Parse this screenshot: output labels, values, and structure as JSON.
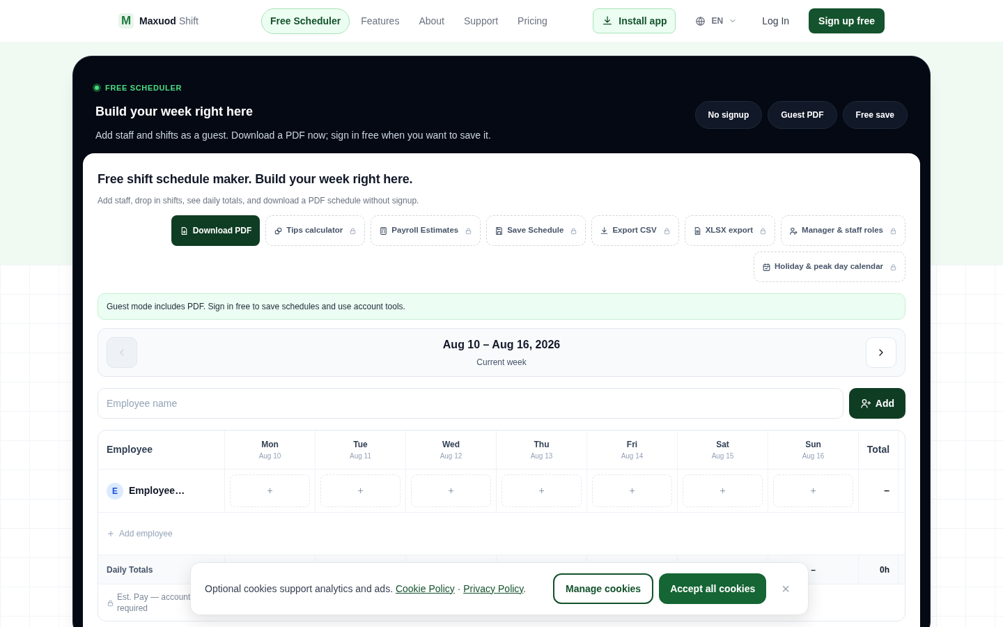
{
  "header": {
    "logo_mark": "M",
    "brand": "Maxuod",
    "brand_suffix": "Shift",
    "nav": [
      {
        "label": "Free Scheduler",
        "selected": true
      },
      {
        "label": "Features",
        "selected": false
      },
      {
        "label": "About",
        "selected": false
      },
      {
        "label": "Support",
        "selected": false
      },
      {
        "label": "Pricing",
        "selected": false
      }
    ],
    "install": "Install app",
    "language": "EN",
    "login": "Log In",
    "signup": "Sign up free"
  },
  "hero": {
    "eyebrow": "FREE SCHEDULER",
    "title": "Build your week right here",
    "subtitle": "Add staff and shifts as a guest. Download a PDF now; sign in free when you want to save it.",
    "pills": [
      "No signup",
      "Guest PDF",
      "Free save"
    ]
  },
  "card": {
    "title": "Free shift schedule maker. Build your week right here.",
    "subtitle": "Add staff, drop in shifts, see daily totals, and download a PDF schedule without signup.",
    "actions": [
      {
        "label": "Download PDF",
        "kind": "primary",
        "locked": false
      },
      {
        "label": "Tips calculator",
        "kind": "tool",
        "locked": true
      },
      {
        "label": "Payroll Estimates",
        "kind": "tool",
        "locked": true
      },
      {
        "label": "Save Schedule",
        "kind": "tool",
        "locked": true
      },
      {
        "label": "Export CSV",
        "kind": "tool",
        "locked": true
      },
      {
        "label": "XLSX export",
        "kind": "tool",
        "locked": true
      },
      {
        "label": "Manager & staff roles",
        "kind": "tool",
        "locked": true
      },
      {
        "label": "Holiday & peak day calendar",
        "kind": "tool",
        "locked": true
      }
    ],
    "notice": "Guest mode includes PDF. Sign in free to save schedules and use account tools.",
    "week": {
      "range": "Aug 10 – Aug 16, 2026",
      "caption": "Current week",
      "prev_disabled": true,
      "next_disabled": false
    },
    "employee_input": {
      "placeholder": "Employee name"
    },
    "add_button": "Add",
    "table": {
      "employee_heading": "Employee",
      "days": [
        {
          "day": "Mon",
          "date": "Aug 10"
        },
        {
          "day": "Tue",
          "date": "Aug 11"
        },
        {
          "day": "Wed",
          "date": "Aug 12"
        },
        {
          "day": "Thu",
          "date": "Aug 13"
        },
        {
          "day": "Fri",
          "date": "Aug 14"
        },
        {
          "day": "Sat",
          "date": "Aug 15"
        },
        {
          "day": "Sun",
          "date": "Aug 16"
        }
      ],
      "total_heading": "Total",
      "rows": [
        {
          "avatar": "E",
          "name": "Employee…",
          "cells": [
            "+",
            "+",
            "+",
            "+",
            "+",
            "+",
            "+"
          ],
          "total": "–"
        }
      ],
      "add_employee": "Add employee",
      "daily_totals": {
        "label": "Daily Totals",
        "sun_value": "–",
        "total": "0h"
      },
      "est_pay": "Est. Pay — account required"
    }
  },
  "cookie_banner": {
    "text": "Optional cookies support analytics and ads.",
    "links": [
      "Cookie Policy",
      "Privacy Policy"
    ],
    "separator": "·",
    "end": ".",
    "manage": "Manage cookies",
    "accept": "Accept all cookies",
    "close": "×"
  }
}
